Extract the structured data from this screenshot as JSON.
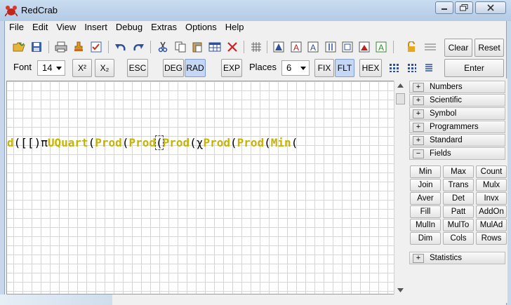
{
  "app": {
    "title": "RedCrab"
  },
  "menu": [
    "File",
    "Edit",
    "View",
    "Insert",
    "Debug",
    "Extras",
    "Options",
    "Help"
  ],
  "toolbar": {
    "clear_label": "Clear",
    "reset_label": "Reset",
    "enter_label": "Enter"
  },
  "format_bar": {
    "font_label": "Font",
    "font_size": "14",
    "superscript": "X²",
    "subscript": "X₂",
    "esc": "ESC",
    "deg": "DEG",
    "rad": "RAD",
    "exp": "EXP",
    "places_label": "Places",
    "places_value": "6",
    "fix": "FIX",
    "flt": "FLT",
    "hex": "HEX"
  },
  "formula": {
    "tokens": [
      {
        "t": "d",
        "k": "fn"
      },
      {
        "t": "(",
        "k": "pn"
      },
      {
        "t": "[",
        "k": "pn"
      },
      {
        "t": "[",
        "k": "pn"
      },
      {
        "t": ")",
        "k": "pn"
      },
      {
        "t": "π",
        "k": "pn"
      },
      {
        "t": "UQuart",
        "k": "fn"
      },
      {
        "t": "(",
        "k": "pn"
      },
      {
        "t": "Prod",
        "k": "fn"
      },
      {
        "t": "(",
        "k": "pn"
      },
      {
        "t": "Prod",
        "k": "fn"
      },
      {
        "t": "(",
        "k": "cur"
      },
      {
        "t": "Prod",
        "k": "fn"
      },
      {
        "t": "(",
        "k": "pn"
      },
      {
        "t": "χ",
        "k": "pn"
      },
      {
        "t": "Prod",
        "k": "fn"
      },
      {
        "t": "(",
        "k": "pn"
      },
      {
        "t": "Prod",
        "k": "fn"
      },
      {
        "t": "(",
        "k": "pn"
      },
      {
        "t": "Min",
        "k": "fn"
      },
      {
        "t": "(",
        "k": "pn"
      }
    ]
  },
  "categories": [
    {
      "label": "Numbers",
      "expanded": false
    },
    {
      "label": "Scientific",
      "expanded": false
    },
    {
      "label": "Symbol",
      "expanded": false
    },
    {
      "label": "Programmers",
      "expanded": false
    },
    {
      "label": "Standard",
      "expanded": false
    },
    {
      "label": "Fields",
      "expanded": true
    }
  ],
  "field_buttons": [
    "Min",
    "Max",
    "Count",
    "Join",
    "Trans",
    "Mulx",
    "Aver",
    "Det",
    "Invx",
    "Fill",
    "Patt",
    "AddOn",
    "MulIn",
    "MulTo",
    "MulAd",
    "Dim",
    "Cols",
    "Rows"
  ],
  "statistics": {
    "label": "Statistics",
    "expanded": false
  },
  "expand_symbols": {
    "collapsed": "+",
    "expanded": "−"
  }
}
